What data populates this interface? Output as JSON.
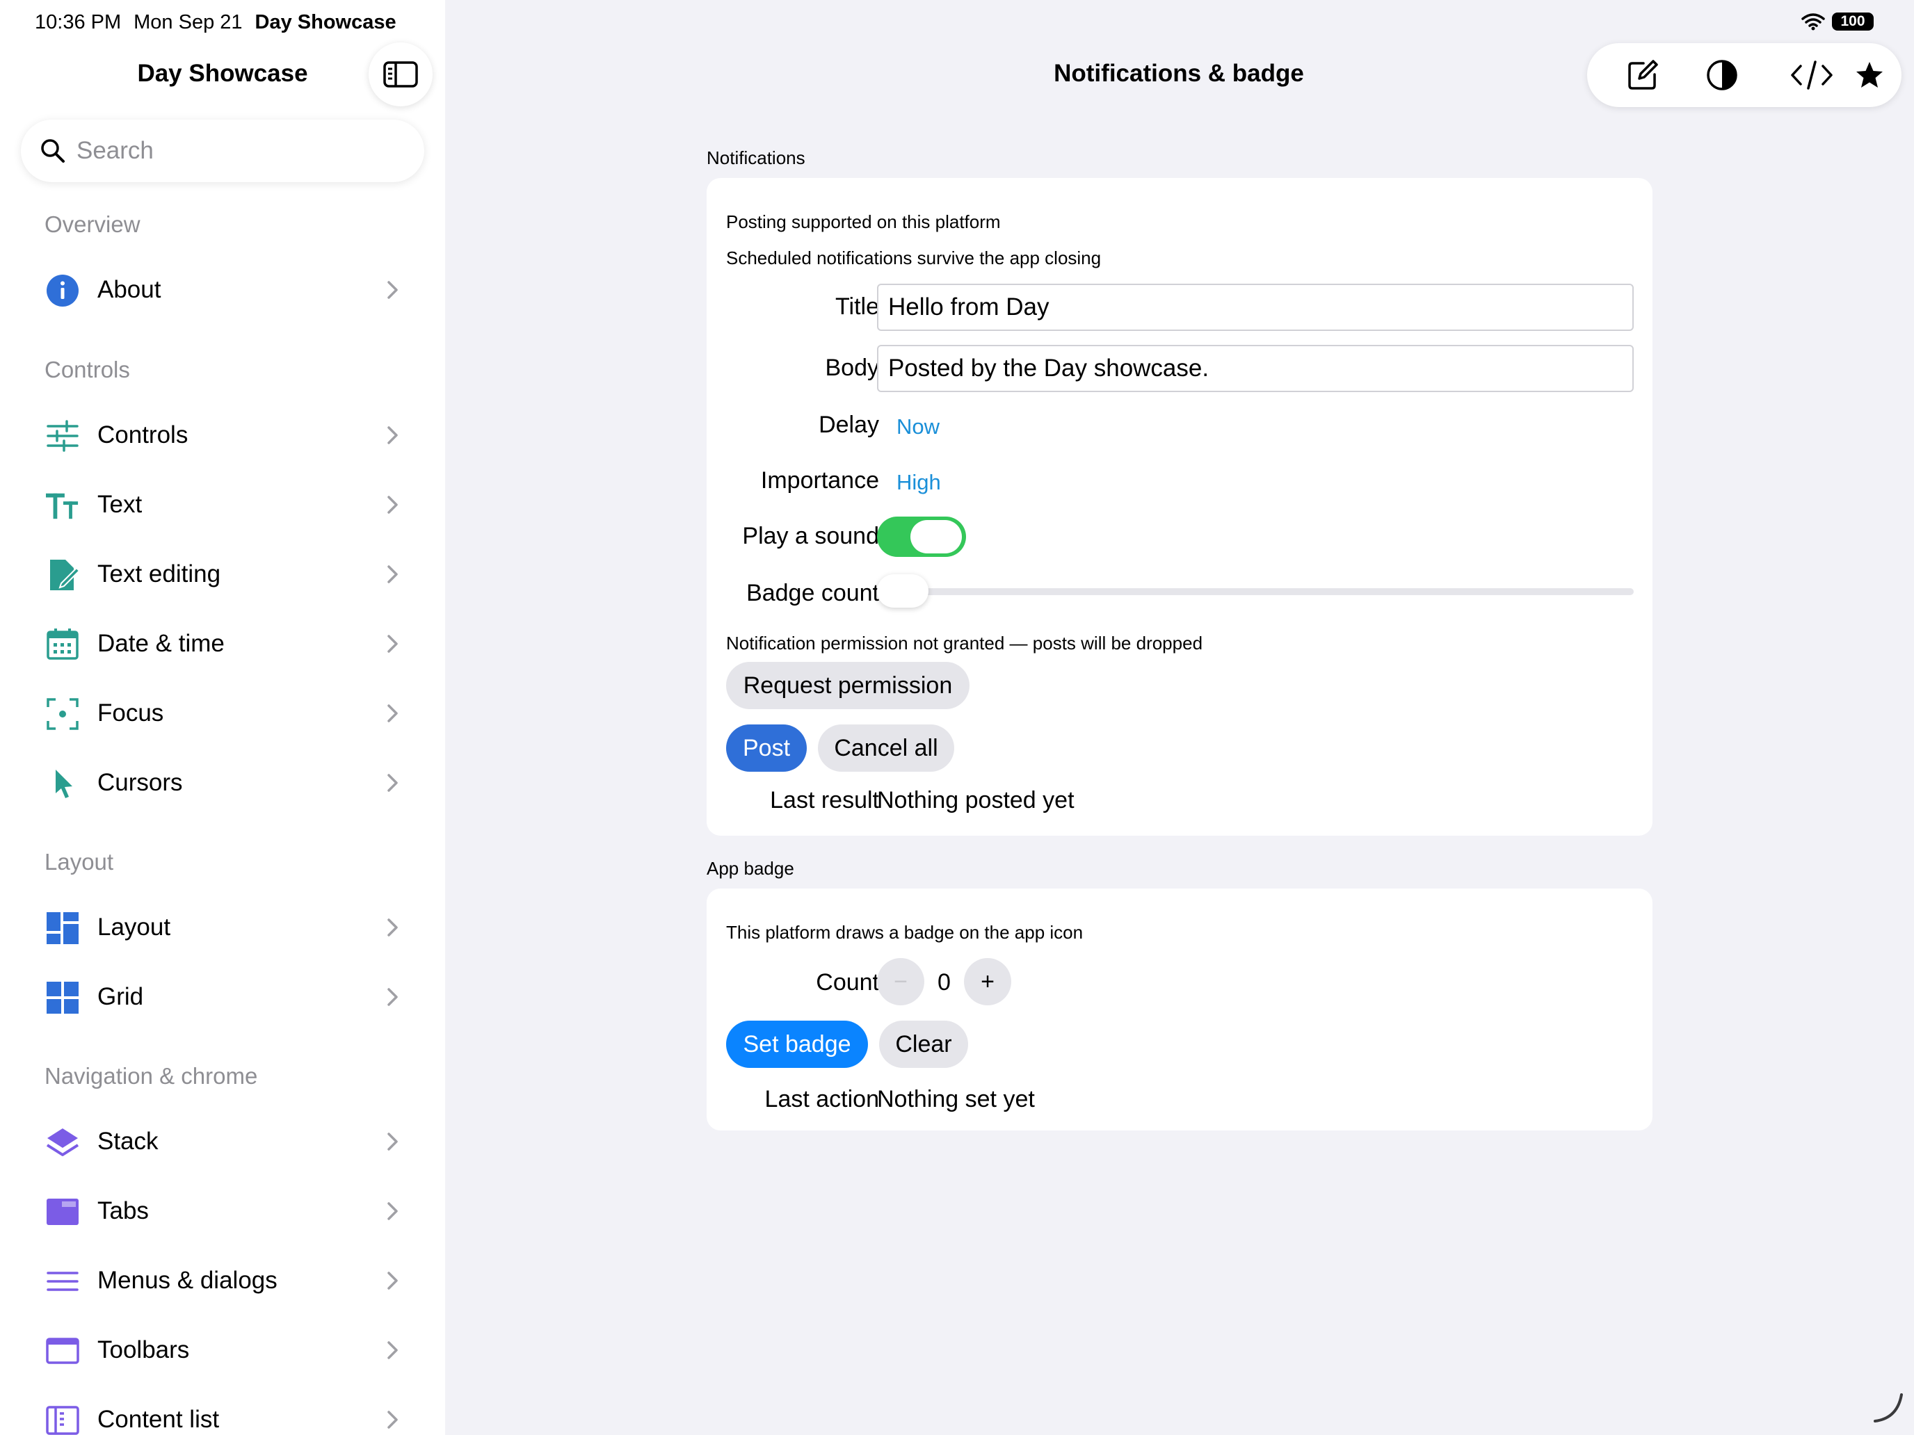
{
  "status_bar": {
    "time": "10:36 PM",
    "date": "Mon Sep 21",
    "app": "Day Showcase",
    "battery": "100"
  },
  "sidebar": {
    "title": "Day Showcase",
    "search_placeholder": "Search",
    "sections": [
      {
        "header": "Overview",
        "items": [
          {
            "label": "About",
            "icon": "info-icon"
          }
        ]
      },
      {
        "header": "Controls",
        "items": [
          {
            "label": "Controls",
            "icon": "sliders-icon"
          },
          {
            "label": "Text",
            "icon": "text-size-icon"
          },
          {
            "label": "Text editing",
            "icon": "document-edit-icon"
          },
          {
            "label": "Date & time",
            "icon": "calendar-icon"
          },
          {
            "label": "Focus",
            "icon": "focus-icon"
          },
          {
            "label": "Cursors",
            "icon": "cursor-icon"
          }
        ]
      },
      {
        "header": "Layout",
        "items": [
          {
            "label": "Layout",
            "icon": "layout-icon"
          },
          {
            "label": "Grid",
            "icon": "grid-icon"
          }
        ]
      },
      {
        "header": "Navigation & chrome",
        "items": [
          {
            "label": "Stack",
            "icon": "stack-icon"
          },
          {
            "label": "Tabs",
            "icon": "tabs-icon"
          },
          {
            "label": "Menus & dialogs",
            "icon": "menu-lines-icon"
          },
          {
            "label": "Toolbars",
            "icon": "toolbar-icon"
          },
          {
            "label": "Content list",
            "icon": "content-list-icon"
          }
        ]
      }
    ]
  },
  "main": {
    "title": "Notifications & badge",
    "toolbar": [
      "compose-icon",
      "contrast-icon",
      "code-icon",
      "star-icon"
    ],
    "notifications": {
      "header": "Notifications",
      "info_1": "Posting supported on this platform",
      "info_2": "Scheduled notifications survive the app closing",
      "title_label": "Title",
      "title_value": "Hello from Day",
      "body_label": "Body",
      "body_value": "Posted by the Day showcase.",
      "delay_label": "Delay",
      "delay_value": "Now",
      "importance_label": "Importance",
      "importance_value": "High",
      "sound_label": "Play a sound",
      "sound_on": true,
      "badge_label": "Badge count",
      "badge_slider_value": 0,
      "permission_note": "Notification permission not granted — posts will be dropped",
      "request_button": "Request permission",
      "post_button": "Post",
      "cancel_button": "Cancel all",
      "result_label": "Last result",
      "result_value": "Nothing posted yet"
    },
    "app_badge": {
      "header": "App badge",
      "info": "This platform draws a badge on the app icon",
      "count_label": "Count",
      "count_value": "0",
      "minus": "−",
      "plus": "+",
      "set_button": "Set badge",
      "clear_button": "Clear",
      "action_label": "Last action",
      "action_value": "Nothing set yet"
    }
  },
  "colors": {
    "accent_blue": "#2f6fd8",
    "bright_blue": "#0a84ff",
    "link_blue": "#1a8fd8",
    "toggle_green": "#34c759",
    "icon_teal": "#2a9d8f",
    "icon_blue": "#2f6fd8",
    "icon_purple": "#7b5ce6"
  }
}
